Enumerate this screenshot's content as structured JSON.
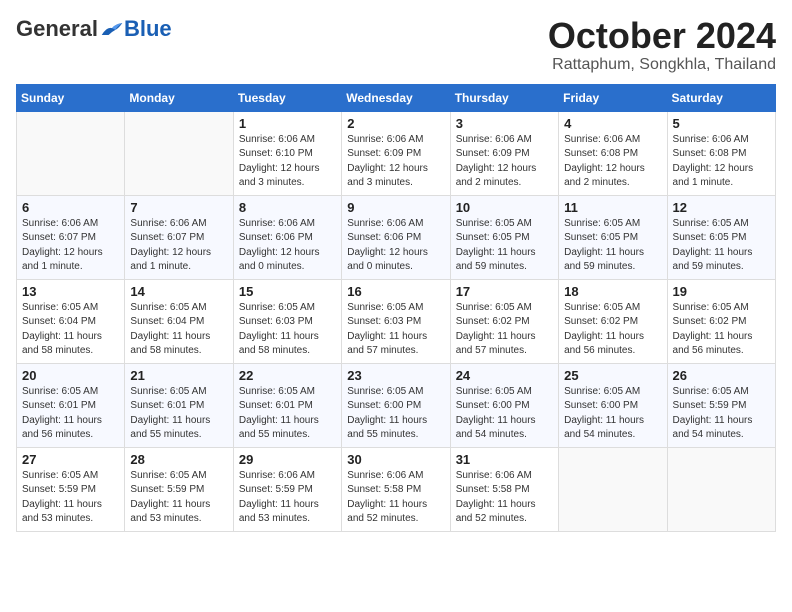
{
  "logo": {
    "general": "General",
    "blue": "Blue"
  },
  "title": "October 2024",
  "subtitle": "Rattaphum, Songkhla, Thailand",
  "headers": [
    "Sunday",
    "Monday",
    "Tuesday",
    "Wednesday",
    "Thursday",
    "Friday",
    "Saturday"
  ],
  "weeks": [
    [
      {
        "day": "",
        "detail": ""
      },
      {
        "day": "",
        "detail": ""
      },
      {
        "day": "1",
        "detail": "Sunrise: 6:06 AM\nSunset: 6:10 PM\nDaylight: 12 hours\nand 3 minutes."
      },
      {
        "day": "2",
        "detail": "Sunrise: 6:06 AM\nSunset: 6:09 PM\nDaylight: 12 hours\nand 3 minutes."
      },
      {
        "day": "3",
        "detail": "Sunrise: 6:06 AM\nSunset: 6:09 PM\nDaylight: 12 hours\nand 2 minutes."
      },
      {
        "day": "4",
        "detail": "Sunrise: 6:06 AM\nSunset: 6:08 PM\nDaylight: 12 hours\nand 2 minutes."
      },
      {
        "day": "5",
        "detail": "Sunrise: 6:06 AM\nSunset: 6:08 PM\nDaylight: 12 hours\nand 1 minute."
      }
    ],
    [
      {
        "day": "6",
        "detail": "Sunrise: 6:06 AM\nSunset: 6:07 PM\nDaylight: 12 hours\nand 1 minute."
      },
      {
        "day": "7",
        "detail": "Sunrise: 6:06 AM\nSunset: 6:07 PM\nDaylight: 12 hours\nand 1 minute."
      },
      {
        "day": "8",
        "detail": "Sunrise: 6:06 AM\nSunset: 6:06 PM\nDaylight: 12 hours\nand 0 minutes."
      },
      {
        "day": "9",
        "detail": "Sunrise: 6:06 AM\nSunset: 6:06 PM\nDaylight: 12 hours\nand 0 minutes."
      },
      {
        "day": "10",
        "detail": "Sunrise: 6:05 AM\nSunset: 6:05 PM\nDaylight: 11 hours\nand 59 minutes."
      },
      {
        "day": "11",
        "detail": "Sunrise: 6:05 AM\nSunset: 6:05 PM\nDaylight: 11 hours\nand 59 minutes."
      },
      {
        "day": "12",
        "detail": "Sunrise: 6:05 AM\nSunset: 6:05 PM\nDaylight: 11 hours\nand 59 minutes."
      }
    ],
    [
      {
        "day": "13",
        "detail": "Sunrise: 6:05 AM\nSunset: 6:04 PM\nDaylight: 11 hours\nand 58 minutes."
      },
      {
        "day": "14",
        "detail": "Sunrise: 6:05 AM\nSunset: 6:04 PM\nDaylight: 11 hours\nand 58 minutes."
      },
      {
        "day": "15",
        "detail": "Sunrise: 6:05 AM\nSunset: 6:03 PM\nDaylight: 11 hours\nand 58 minutes."
      },
      {
        "day": "16",
        "detail": "Sunrise: 6:05 AM\nSunset: 6:03 PM\nDaylight: 11 hours\nand 57 minutes."
      },
      {
        "day": "17",
        "detail": "Sunrise: 6:05 AM\nSunset: 6:02 PM\nDaylight: 11 hours\nand 57 minutes."
      },
      {
        "day": "18",
        "detail": "Sunrise: 6:05 AM\nSunset: 6:02 PM\nDaylight: 11 hours\nand 56 minutes."
      },
      {
        "day": "19",
        "detail": "Sunrise: 6:05 AM\nSunset: 6:02 PM\nDaylight: 11 hours\nand 56 minutes."
      }
    ],
    [
      {
        "day": "20",
        "detail": "Sunrise: 6:05 AM\nSunset: 6:01 PM\nDaylight: 11 hours\nand 56 minutes."
      },
      {
        "day": "21",
        "detail": "Sunrise: 6:05 AM\nSunset: 6:01 PM\nDaylight: 11 hours\nand 55 minutes."
      },
      {
        "day": "22",
        "detail": "Sunrise: 6:05 AM\nSunset: 6:01 PM\nDaylight: 11 hours\nand 55 minutes."
      },
      {
        "day": "23",
        "detail": "Sunrise: 6:05 AM\nSunset: 6:00 PM\nDaylight: 11 hours\nand 55 minutes."
      },
      {
        "day": "24",
        "detail": "Sunrise: 6:05 AM\nSunset: 6:00 PM\nDaylight: 11 hours\nand 54 minutes."
      },
      {
        "day": "25",
        "detail": "Sunrise: 6:05 AM\nSunset: 6:00 PM\nDaylight: 11 hours\nand 54 minutes."
      },
      {
        "day": "26",
        "detail": "Sunrise: 6:05 AM\nSunset: 5:59 PM\nDaylight: 11 hours\nand 54 minutes."
      }
    ],
    [
      {
        "day": "27",
        "detail": "Sunrise: 6:05 AM\nSunset: 5:59 PM\nDaylight: 11 hours\nand 53 minutes."
      },
      {
        "day": "28",
        "detail": "Sunrise: 6:05 AM\nSunset: 5:59 PM\nDaylight: 11 hours\nand 53 minutes."
      },
      {
        "day": "29",
        "detail": "Sunrise: 6:06 AM\nSunset: 5:59 PM\nDaylight: 11 hours\nand 53 minutes."
      },
      {
        "day": "30",
        "detail": "Sunrise: 6:06 AM\nSunset: 5:58 PM\nDaylight: 11 hours\nand 52 minutes."
      },
      {
        "day": "31",
        "detail": "Sunrise: 6:06 AM\nSunset: 5:58 PM\nDaylight: 11 hours\nand 52 minutes."
      },
      {
        "day": "",
        "detail": ""
      },
      {
        "day": "",
        "detail": ""
      }
    ]
  ]
}
